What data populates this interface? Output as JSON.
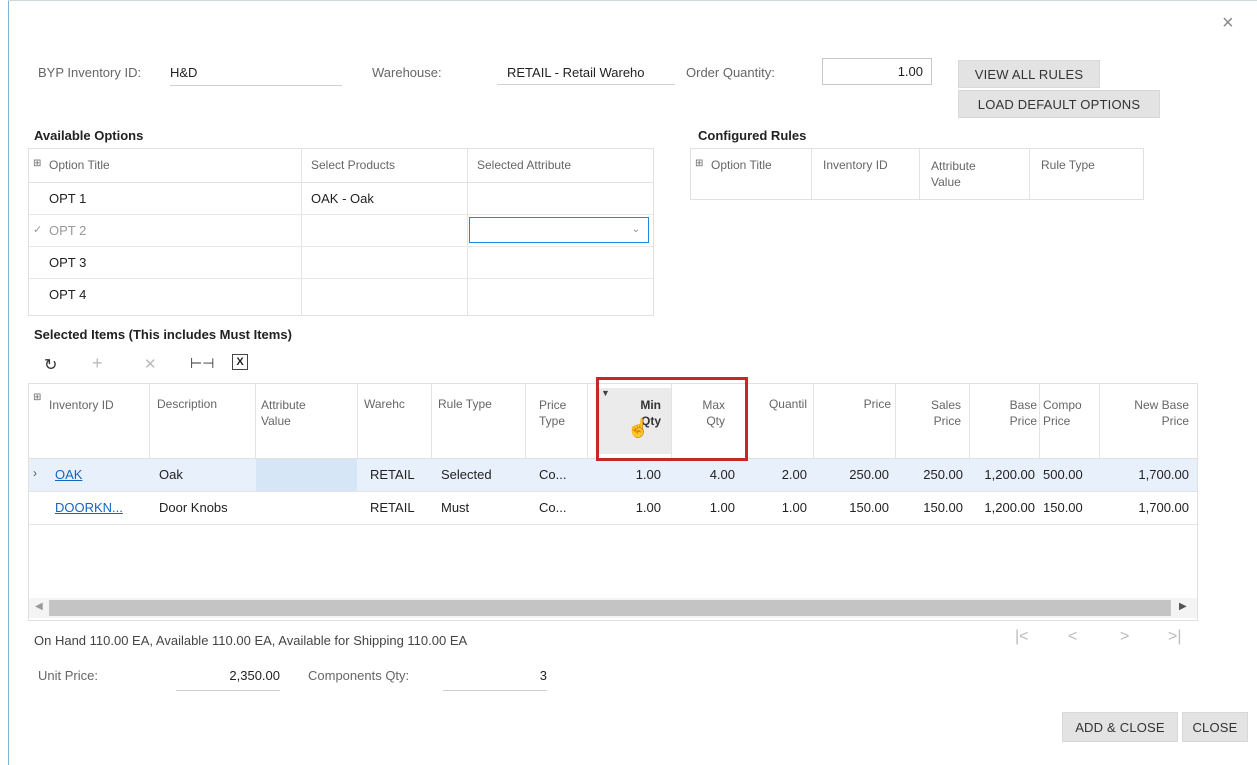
{
  "dialog": {
    "close_icon_glyph": "×"
  },
  "header": {
    "inventory_id_label": "BYP Inventory ID:",
    "inventory_id_value": "H&D",
    "warehouse_label": "Warehouse:",
    "warehouse_value": "RETAIL - Retail Wareho",
    "order_qty_label": "Order Quantity:",
    "order_qty_value": "1.00",
    "view_all_rules": "VIEW ALL RULES",
    "load_default_options": "LOAD DEFAULT OPTIONS"
  },
  "available_options": {
    "title": "Available Options",
    "columns": [
      "Option Title",
      "Select Products",
      "Selected Attribute"
    ],
    "rows": [
      {
        "title": "OPT 1",
        "product": "OAK - Oak",
        "attribute": ""
      },
      {
        "title": "OPT 2",
        "product": "",
        "attribute": ""
      },
      {
        "title": "OPT 3",
        "product": "",
        "attribute": ""
      },
      {
        "title": "OPT 4",
        "product": "",
        "attribute": ""
      }
    ]
  },
  "configured_rules": {
    "title": "Configured Rules",
    "columns": [
      "Option Title",
      "Inventory ID",
      "Attribute Value",
      "Rule Type"
    ]
  },
  "selected_items": {
    "title": "Selected Items (This includes Must Items)",
    "columns": {
      "inventory_id": "Inventory ID",
      "description": "Description",
      "attribute_value": "Attribute Value",
      "warehouse": "Warehc",
      "rule_type": "Rule Type",
      "price_type": "Price Type",
      "min_qty": "Min Qty",
      "max_qty": "Max Qty",
      "quantity": "Quantil",
      "price": "Price",
      "sales_price": "Sales Price",
      "base_price": "Base Price",
      "compo_price": "Compo Price",
      "new_base_price": "New Base Price"
    },
    "rows": [
      {
        "inventory_id": "OAK",
        "description": "Oak",
        "attribute_value": "",
        "warehouse": "RETAIL",
        "rule_type": "Selected",
        "price_type": "Co...",
        "min_qty": "1.00",
        "max_qty": "4.00",
        "quantity": "2.00",
        "price": "250.00",
        "sales_price": "250.00",
        "base_price": "1,200.00",
        "compo_price": "500.00",
        "new_base_price": "1,700.00"
      },
      {
        "inventory_id": "DOORKN...",
        "description": "Door Knobs",
        "attribute_value": "",
        "warehouse": "RETAIL",
        "rule_type": "Must",
        "price_type": "Co...",
        "min_qty": "1.00",
        "max_qty": "1.00",
        "quantity": "1.00",
        "price": "150.00",
        "sales_price": "150.00",
        "base_price": "1,200.00",
        "compo_price": "150.00",
        "new_base_price": "1,700.00"
      }
    ]
  },
  "footer": {
    "availability": "On Hand 110.00 EA, Available 110.00 EA, Available for Shipping 110.00 EA",
    "unit_price_label": "Unit Price:",
    "unit_price_value": "2,350.00",
    "components_qty_label": "Components Qty:",
    "components_qty_value": "3",
    "add_close": "ADD & CLOSE",
    "close": "CLOSE"
  },
  "colors": {
    "highlight_box": "#c62828",
    "selected_row": "#e8f1fb",
    "link": "#1565c0"
  }
}
